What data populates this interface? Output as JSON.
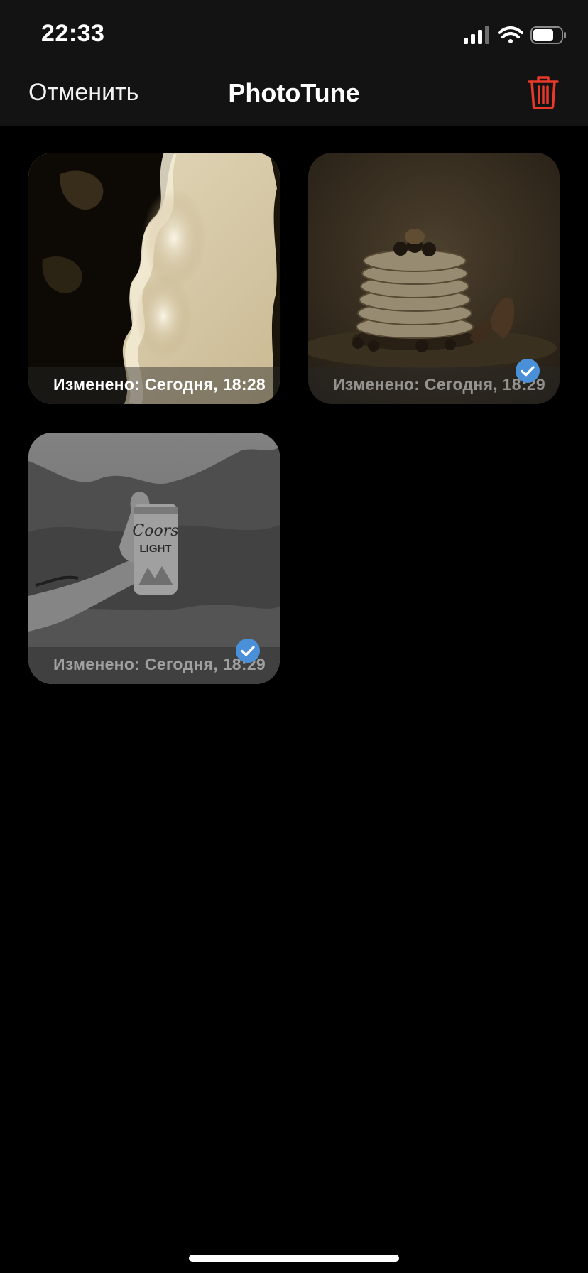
{
  "status_bar": {
    "time": "22:33",
    "icons": [
      "cellular-signal-icon",
      "wifi-icon",
      "battery-icon"
    ]
  },
  "nav": {
    "cancel_label": "Отменить",
    "title": "PhotoTune",
    "delete_icon": "trash-icon"
  },
  "colors": {
    "accent_red": "#E8392A",
    "check_blue": "#4A90D9",
    "topbar_bg": "#131313",
    "background": "#000000"
  },
  "photos": [
    {
      "caption": "Изменено: Сегодня, 18:28",
      "selected": false,
      "subject": "sepia coastline aerial"
    },
    {
      "caption": "Изменено: Сегодня, 18:29",
      "selected": true,
      "subject": "pancake stack"
    },
    {
      "caption": "Изменено: Сегодня, 18:29",
      "selected": true,
      "subject": "hand holding can"
    }
  ]
}
